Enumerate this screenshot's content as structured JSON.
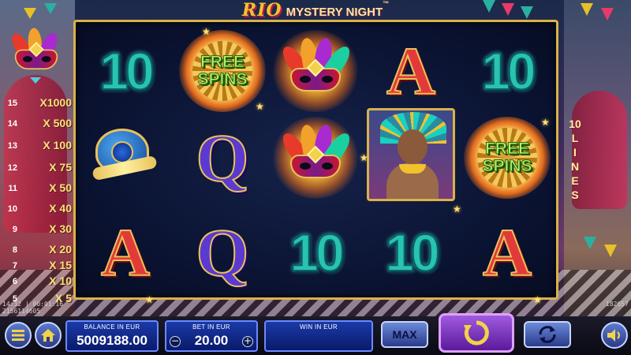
{
  "title": {
    "rio": "RIO",
    "main": "MYSTERY NIGHT",
    "tm": "™"
  },
  "reels": {
    "symbols": {
      "ten": "10",
      "a": "A",
      "q": "Q",
      "free_spins": [
        "FREE",
        "SPINS"
      ]
    }
  },
  "paytable": [
    {
      "line": "15",
      "multiplier": "X1000"
    },
    {
      "line": "14",
      "multiplier": "X 500"
    },
    {
      "line": "13",
      "multiplier": "X 100"
    },
    {
      "line": "12",
      "multiplier": "X 75"
    },
    {
      "line": "11",
      "multiplier": "X 50"
    },
    {
      "line": "10",
      "multiplier": "X 40"
    },
    {
      "line": "9",
      "multiplier": "X 30"
    },
    {
      "line": "8",
      "multiplier": "X 20"
    },
    {
      "line": "7",
      "multiplier": "X 15"
    },
    {
      "line": "6",
      "multiplier": "X 10"
    },
    {
      "line": "5",
      "multiplier": "X 5"
    }
  ],
  "lines_label": {
    "count": "10",
    "word": [
      "L",
      "I",
      "N",
      "E",
      "S"
    ]
  },
  "info": {
    "clock": "14:32 | 00:01:16",
    "id": "2156114605",
    "right_code": "182657"
  },
  "controls": {
    "balance": {
      "label": "BALANCE IN EUR",
      "value": "5009188.00"
    },
    "bet": {
      "label": "BET IN EUR",
      "value": "20.00",
      "minus": "−",
      "plus": "+"
    },
    "win": {
      "label": "WIN IN EUR",
      "value": ""
    },
    "max_label": "MAX"
  },
  "colors": {
    "accent_gold": "#d9b24a",
    "panel_blue": "#1a3aa8",
    "spin_purple": "#a05ae0"
  }
}
